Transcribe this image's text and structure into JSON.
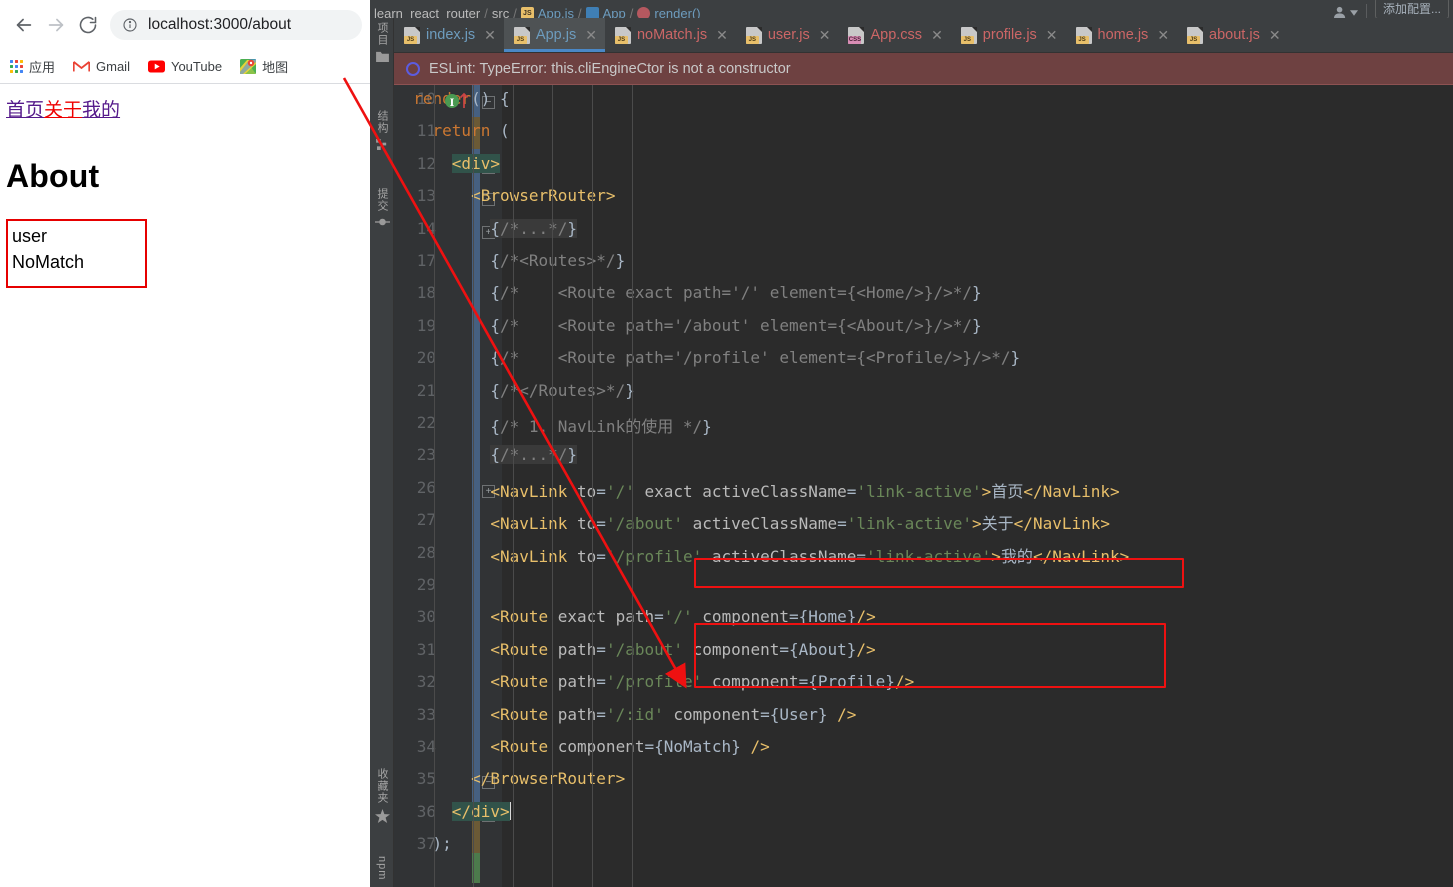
{
  "browser": {
    "nav": {
      "back_icon": "arrow-left-icon",
      "forward_icon": "arrow-right-icon",
      "reload_icon": "reload-icon",
      "info_icon": "info-circle-icon"
    },
    "url": {
      "host": "localhost:3000",
      "path": "/about",
      "full": "localhost:3000/about"
    },
    "bookmarks": [
      {
        "label": "应用",
        "icon": "apps-grid-icon"
      },
      {
        "label": "Gmail",
        "icon": "gmail-icon"
      },
      {
        "label": "YouTube",
        "icon": "youtube-icon"
      },
      {
        "label": "地图",
        "icon": "google-maps-icon"
      }
    ],
    "page": {
      "nav_links": [
        {
          "label": "首页",
          "state": "visited"
        },
        {
          "label": "关于",
          "state": "active"
        },
        {
          "label": "我的",
          "state": "visited"
        }
      ],
      "heading": "About",
      "output_box_lines": [
        "user",
        "NoMatch"
      ]
    }
  },
  "ide": {
    "breadcrumb": {
      "project": "learn_react_router",
      "folder": "src",
      "file": "App.js",
      "class": "App",
      "method": "render()"
    },
    "topbar": {
      "run_config_label": "添加配置...",
      "person_icon": "person-dropdown-icon"
    },
    "rail": {
      "top": [
        {
          "label": "项目",
          "icon": "project-icon"
        },
        {
          "label": "结构",
          "icon": "structure-icon"
        },
        {
          "label": "提交",
          "icon": "commit-icon"
        }
      ],
      "bottom": [
        {
          "label": "收藏夹",
          "icon": "star-icon"
        },
        {
          "label": "npm",
          "icon": "npm-icon"
        }
      ]
    },
    "tabs": [
      {
        "label": "index.js",
        "type": "js",
        "color": "blue",
        "selected": false
      },
      {
        "label": "App.js",
        "type": "js",
        "color": "blue",
        "selected": true
      },
      {
        "label": "noMatch.js",
        "type": "js",
        "color": "red",
        "selected": false
      },
      {
        "label": "user.js",
        "type": "js",
        "color": "red",
        "selected": false
      },
      {
        "label": "App.css",
        "type": "css",
        "color": "red",
        "selected": false
      },
      {
        "label": "profile.js",
        "type": "js",
        "color": "red",
        "selected": false
      },
      {
        "label": "home.js",
        "type": "js",
        "color": "red",
        "selected": false
      },
      {
        "label": "about.js",
        "type": "js",
        "color": "red",
        "selected": false
      }
    ],
    "error_banner": {
      "text": "ESLint: TypeError: this.cliEngineCtor is not a constructor",
      "icon": "eslint-error-icon",
      "background": "#6e4141"
    },
    "editor": {
      "line_numbers": [
        "10",
        "11",
        "12",
        "13",
        "14",
        "17",
        "18",
        "19",
        "20",
        "21",
        "22",
        "23",
        "26",
        "27",
        "28",
        "29",
        "30",
        "31",
        "32",
        "33",
        "34",
        "35",
        "36",
        "37"
      ],
      "code_lines": [
        "  render() {",
        "    return (",
        "      <div>",
        "        <BrowserRouter>",
        "          {/*...*/}",
        "          {/*<Routes>*/}",
        "          {/*    <Route exact path='/' element={<Home/>}/>*/}",
        "          {/*    <Route path='/about' element={<About/>}/>*/}",
        "          {/*    <Route path='/profile' element={<Profile/>}/>*/}",
        "          {/*</Routes>*/}",
        "          {/* 1. NavLink的使用 */}",
        "          {/*...*/}",
        "          <NavLink to='/' exact activeClassName='link-active'>首页</NavLink>",
        "          <NavLink to='/about' activeClassName='link-active'>关于</NavLink>",
        "          <NavLink to='/profile' activeClassName='link-active'>我的</NavLink>",
        "",
        "          <Route exact path='/' component={Home}/>",
        "          <Route path='/about' component={About}/>",
        "          <Route path='/profile' component={Profile}/>",
        "          <Route path='/:id' component={User} />",
        "          <Route component={NoMatch} />",
        "        </BrowserRouter>",
        "      </div>",
        "    );"
      ],
      "highlight_boxes": [
        "<Route path='/about' component={About}/>",
        "<Route path='/:id' component={User} />  +  <Route component={NoMatch} />"
      ],
      "annotation_arrow": "red-arrow-from-url-to-about-route"
    }
  },
  "colors": {
    "accent_red": "#ee1111",
    "ide_bg": "#2b2b2b",
    "gutter_bg": "#313335",
    "chrome_bg": "#3c3f41",
    "tab_selected": "#4e5254",
    "error_bg": "#6e4141"
  }
}
